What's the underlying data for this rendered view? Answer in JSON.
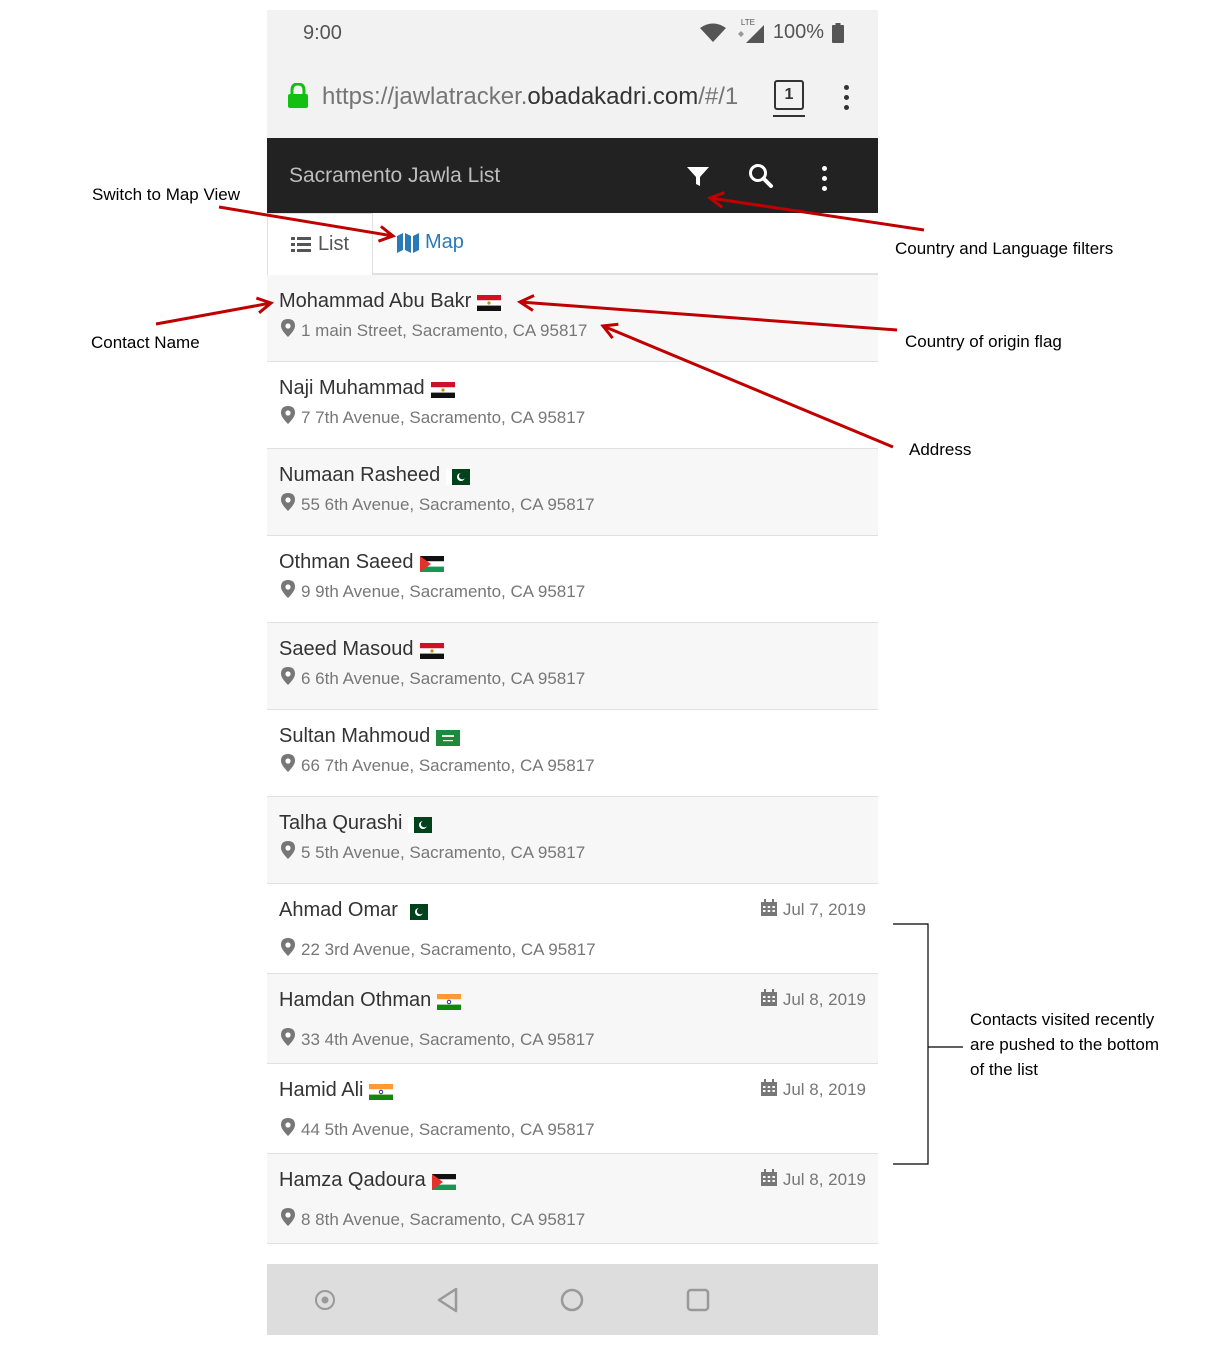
{
  "status_bar": {
    "time": "9:00",
    "network": "LTE",
    "battery": "100%"
  },
  "browser": {
    "url_prefix": "https://jawlatracker.",
    "url_domain": "obadakadri.com",
    "url_suffix": "/#/1",
    "tab_count": "1"
  },
  "app_bar": {
    "title": "Sacramento Jawla List"
  },
  "tabs": {
    "list_label": "List",
    "map_label": "Map"
  },
  "contacts": [
    {
      "name": "Mohammad Abu Bakr",
      "flag": "red-white-black",
      "address": "1 main Street, Sacramento, CA 95817",
      "date": ""
    },
    {
      "name": "Naji Muhammad",
      "flag": "red-white-black",
      "address": "7 7th Avenue, Sacramento, CA 95817",
      "date": ""
    },
    {
      "name": "Numaan Rasheed",
      "flag": "pakistan",
      "address": "55 6th Avenue, Sacramento, CA 95817",
      "date": ""
    },
    {
      "name": "Othman Saeed",
      "flag": "palestine",
      "address": "9 9th Avenue, Sacramento, CA 95817",
      "date": ""
    },
    {
      "name": "Saeed Masoud",
      "flag": "red-white-black",
      "address": "6 6th Avenue, Sacramento, CA 95817",
      "date": ""
    },
    {
      "name": "Sultan Mahmoud",
      "flag": "saudi-arabia",
      "address": "66 7th Avenue, Sacramento, CA 95817",
      "date": ""
    },
    {
      "name": "Talha Qurashi",
      "flag": "pakistan",
      "address": "5 5th Avenue, Sacramento, CA 95817",
      "date": ""
    },
    {
      "name": "Ahmad Omar",
      "flag": "pakistan",
      "address": "22 3rd Avenue, Sacramento, CA 95817",
      "date": "Jul 7, 2019"
    },
    {
      "name": "Hamdan Othman",
      "flag": "india",
      "address": "33 4th Avenue, Sacramento, CA 95817",
      "date": "Jul 8, 2019"
    },
    {
      "name": "Hamid Ali",
      "flag": "india",
      "address": "44 5th Avenue, Sacramento, CA 95817",
      "date": "Jul 8, 2019"
    },
    {
      "name": "Hamza Qadoura",
      "flag": "palestine",
      "address": "8 8th Avenue, Sacramento, CA 95817",
      "date": "Jul 8, 2019"
    }
  ],
  "annotations": {
    "map_view": "Switch to Map View",
    "filters": "Country and Language filters",
    "contact_name": "Contact Name",
    "flag": "Country of origin flag",
    "address": "Address",
    "recent_line1": "Contacts visited recently",
    "recent_line2": "are pushed to the bottom",
    "recent_line3": "of the list"
  },
  "colors": {
    "annotation_arrow": "#c00000",
    "map_link": "#2a7ab5",
    "app_bar": "#222222"
  }
}
